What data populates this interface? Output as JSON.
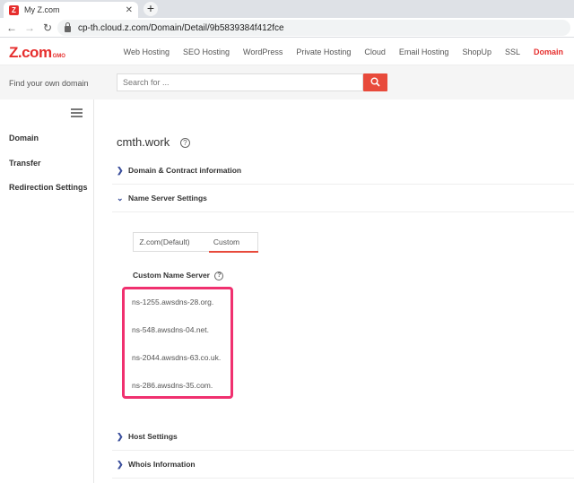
{
  "browser": {
    "tab_title": "My Z.com",
    "tab_favicon": "Z",
    "url": "cp-th.cloud.z.com/Domain/Detail/9b5839384f412fce"
  },
  "header": {
    "logo_main": "Z.com",
    "logo_sub": "GMO",
    "nav": [
      "Web Hosting",
      "SEO Hosting",
      "WordPress",
      "Private Hosting",
      "Cloud",
      "Email Hosting",
      "ShopUp",
      "SSL",
      "Domain"
    ],
    "active_nav": "Domain"
  },
  "search": {
    "label": "Find your own domain",
    "placeholder": "Search for ...",
    "value": ""
  },
  "sidebar": {
    "items": [
      {
        "label": "Domain"
      },
      {
        "label": "Transfer"
      },
      {
        "label": "Redirection Settings"
      }
    ]
  },
  "main": {
    "title": "cmth.work",
    "sections": {
      "domain_contract": "Domain & Contract information",
      "name_server": "Name Server Settings",
      "host": "Host Settings",
      "whois": "Whois Information"
    },
    "ns_tabs": [
      "Z.com(Default)",
      "Custom"
    ],
    "ns_active_tab": "Custom",
    "custom_ns_label": "Custom Name Server",
    "name_servers": [
      "ns-1255.awsdns-28.org.",
      "ns-548.awsdns-04.net.",
      "ns-2044.awsdns-63.co.uk.",
      "ns-286.awsdns-35.com."
    ]
  },
  "colors": {
    "brand": "#e62e2d",
    "highlight": "#f0306f",
    "chevron": "#3b4f9c"
  }
}
